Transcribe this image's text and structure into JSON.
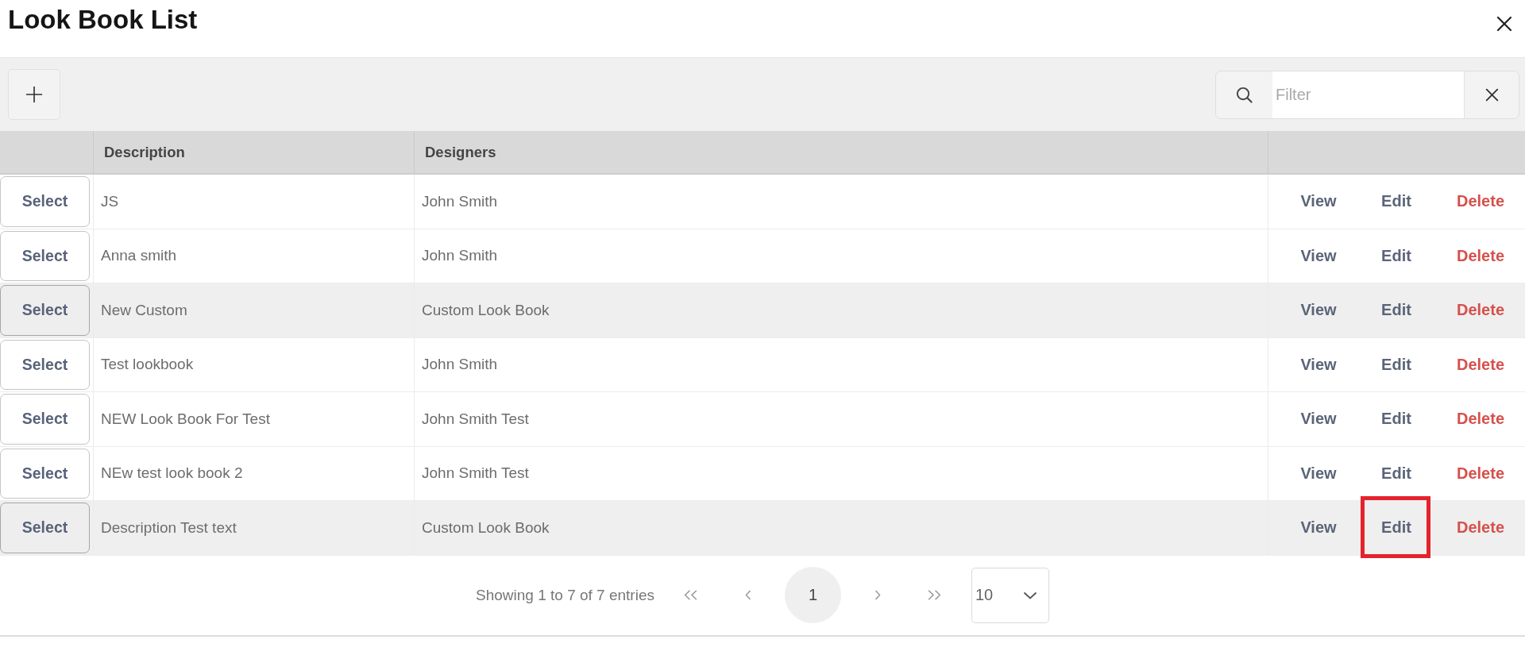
{
  "dialog": {
    "title": "Look Book List"
  },
  "toolbar": {
    "filter": {
      "placeholder": "Filter"
    }
  },
  "table": {
    "columns": [
      "Description",
      "Designers"
    ],
    "rows": [
      {
        "select": "Select",
        "description": "JS",
        "designers": "John Smith",
        "highlighted": false,
        "actions": [
          {
            "kind": "view",
            "label": "View",
            "outlined": false
          },
          {
            "kind": "edit",
            "label": "Edit",
            "outlined": false
          },
          {
            "kind": "delete",
            "label": "Delete",
            "outlined": false
          }
        ]
      },
      {
        "select": "Select",
        "description": "Anna smith",
        "designers": "John Smith",
        "highlighted": false,
        "actions": [
          {
            "kind": "view",
            "label": "View",
            "outlined": false
          },
          {
            "kind": "edit",
            "label": "Edit",
            "outlined": false
          },
          {
            "kind": "delete",
            "label": "Delete",
            "outlined": false
          }
        ]
      },
      {
        "select": "Select",
        "description": "New Custom",
        "designers": "Custom Look Book",
        "highlighted": true,
        "actions": [
          {
            "kind": "view",
            "label": "View",
            "outlined": false
          },
          {
            "kind": "edit",
            "label": "Edit",
            "outlined": false
          },
          {
            "kind": "delete",
            "label": "Delete",
            "outlined": false
          }
        ]
      },
      {
        "select": "Select",
        "description": "Test lookbook",
        "designers": "John Smith",
        "highlighted": false,
        "actions": [
          {
            "kind": "view",
            "label": "View",
            "outlined": false
          },
          {
            "kind": "edit",
            "label": "Edit",
            "outlined": false
          },
          {
            "kind": "delete",
            "label": "Delete",
            "outlined": false
          }
        ]
      },
      {
        "select": "Select",
        "description": "NEW Look Book For Test",
        "designers": "John Smith Test",
        "highlighted": false,
        "actions": [
          {
            "kind": "view",
            "label": "View",
            "outlined": false
          },
          {
            "kind": "edit",
            "label": "Edit",
            "outlined": false
          },
          {
            "kind": "delete",
            "label": "Delete",
            "outlined": false
          }
        ]
      },
      {
        "select": "Select",
        "description": "NEw test look book 2",
        "designers": "John Smith Test",
        "highlighted": false,
        "actions": [
          {
            "kind": "view",
            "label": "View",
            "outlined": false
          },
          {
            "kind": "edit",
            "label": "Edit",
            "outlined": false
          },
          {
            "kind": "delete",
            "label": "Delete",
            "outlined": false
          }
        ]
      },
      {
        "select": "Select",
        "description": "Description Test text",
        "designers": "Custom Look Book",
        "highlighted": true,
        "actions": [
          {
            "kind": "view",
            "label": "View",
            "outlined": false
          },
          {
            "kind": "edit",
            "label": "Edit",
            "outlined": true
          },
          {
            "kind": "delete",
            "label": "Delete",
            "outlined": false
          }
        ]
      }
    ]
  },
  "pagination": {
    "info": "Showing 1 to 7 of 7 entries",
    "pages": [
      {
        "label": "1",
        "selected": true
      }
    ],
    "page_size": "10"
  }
}
